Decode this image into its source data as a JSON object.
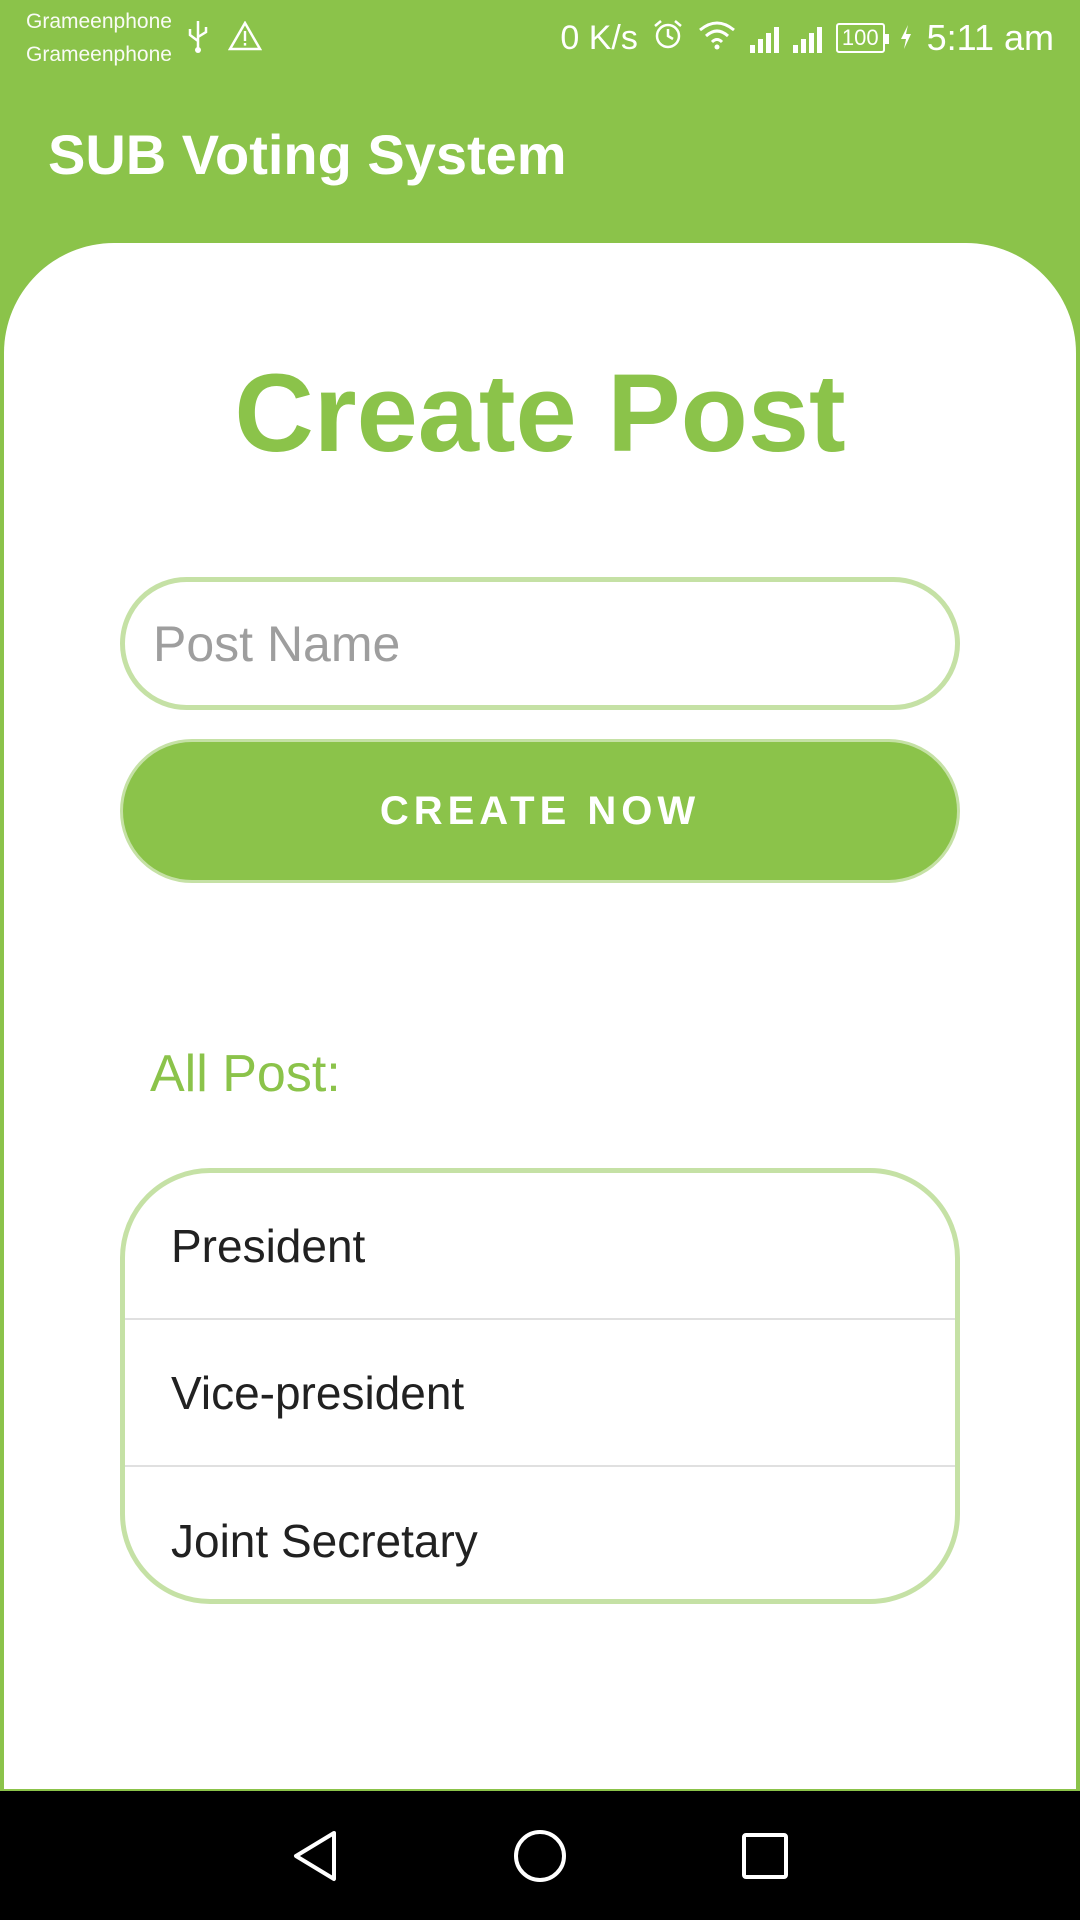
{
  "status_bar": {
    "carrier1": "Grameenphone",
    "carrier2": "Grameenphone",
    "speed": "0 K/s",
    "battery": "100",
    "time": "5:11 am",
    "icons": [
      "usb-icon",
      "warning-icon",
      "alarm-icon",
      "wifi-icon",
      "signal-icon",
      "signal-icon",
      "battery-icon",
      "charging-icon"
    ]
  },
  "app_bar": {
    "title": "SUB Voting System"
  },
  "main": {
    "title": "Create Post",
    "post_name_placeholder": "Post Name",
    "post_name_value": "",
    "create_button_label": "CREATE NOW",
    "all_post_label": "All Post:",
    "posts": [
      "President",
      "Vice-president",
      "Joint Secretary"
    ]
  },
  "nav_bar": {
    "icons": [
      "back-icon",
      "home-icon",
      "recents-icon"
    ]
  },
  "colors": {
    "accent": "#8bc34a",
    "border": "#c5e1a5",
    "nav": "#000000"
  }
}
